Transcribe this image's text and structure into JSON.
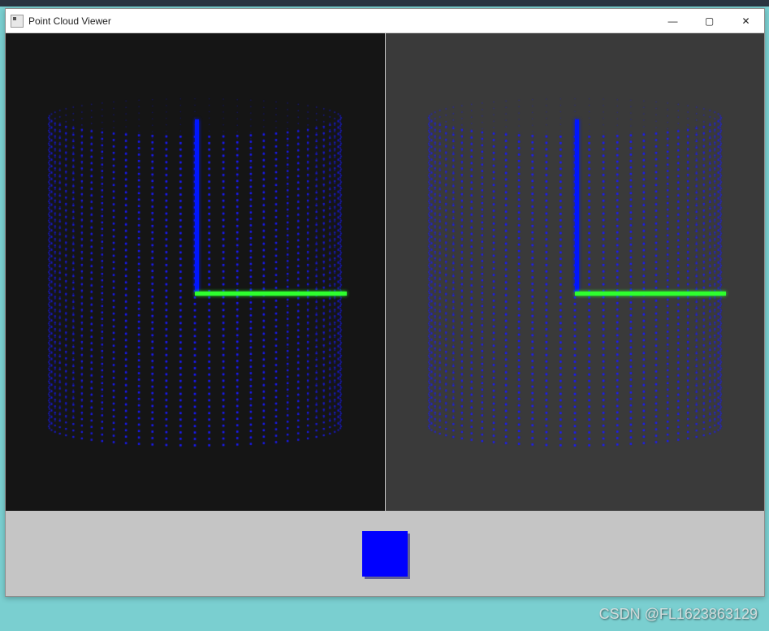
{
  "window": {
    "title": "Point Cloud Viewer"
  },
  "win_controls": {
    "minimize": "—",
    "maximize": "▢",
    "close": "✕"
  },
  "viewports": {
    "left_bg": "#151515",
    "right_bg": "#3a3a3a",
    "point_color": "#1a1aff",
    "axis_z_color": "#0016ff",
    "axis_x_color": "#2eff2e",
    "cloud_shape": "cylinder",
    "cloud_description": "blue point cloud cylinder with green X axis and blue Z axis"
  },
  "bottom_panel": {
    "preview_shape": "cube",
    "preview_color": "#0000ff"
  },
  "watermark": {
    "text": "CSDN @FL1623863129"
  }
}
